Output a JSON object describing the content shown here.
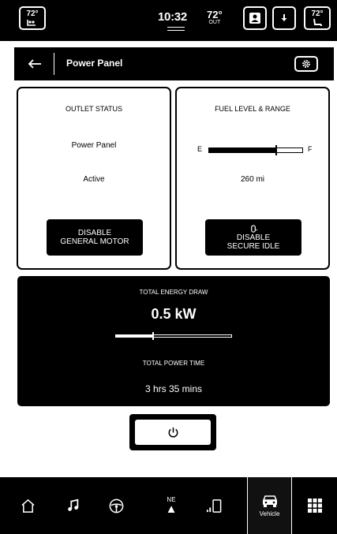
{
  "status_bar": {
    "driver_seat_temp": "72°",
    "time": "10:32",
    "outside_temp": "72°",
    "outside_label": "OUT",
    "passenger_seat_temp": "72°"
  },
  "header": {
    "title": "Power Panel"
  },
  "outlet_card": {
    "title": "OUTLET STATUS",
    "source": "Power Panel",
    "state": "Active",
    "button_line1": "DISABLE",
    "button_line2": "GENERAL MOTOR"
  },
  "fuel_card": {
    "title": "FUEL LEVEL & RANGE",
    "empty_label": "E",
    "full_label": "F",
    "fuel_level_fraction": 0.72,
    "range": "260 mi",
    "button_line1": "DISABLE",
    "button_line2": "SECURE IDLE"
  },
  "energy_panel": {
    "draw_label": "TOTAL ENERGY DRAW",
    "draw_value": "0.5 kW",
    "draw_fraction": 0.32,
    "time_label": "TOTAL POWER TIME",
    "time_value": "3 hrs 35 mins"
  },
  "bottom_nav": {
    "compass_heading": "NE",
    "vehicle_label": "Vehicle"
  }
}
